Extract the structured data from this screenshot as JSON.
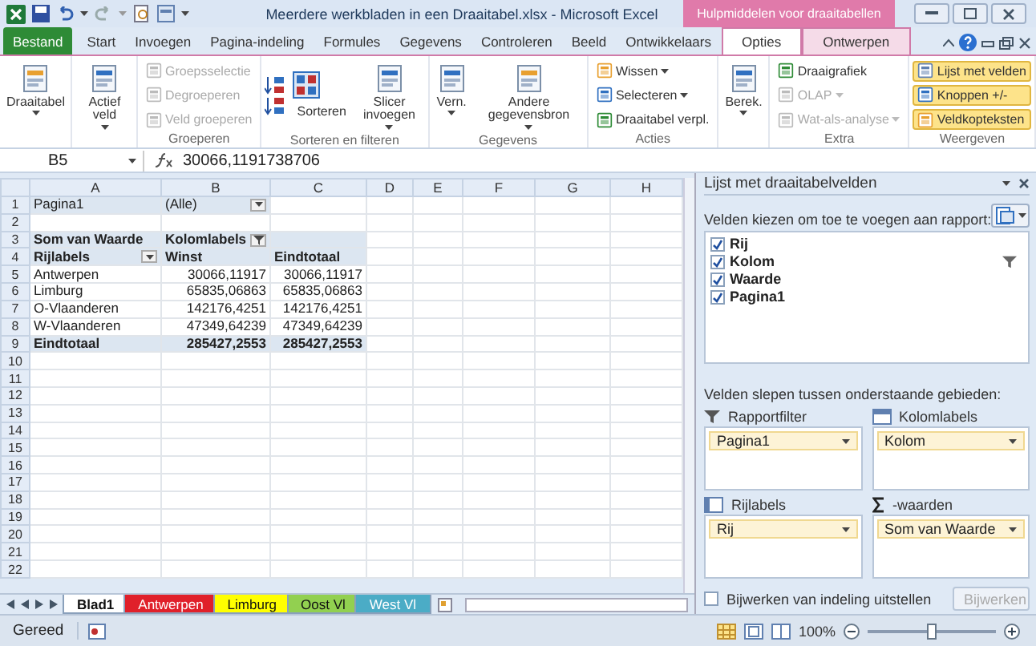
{
  "window": {
    "title": "Meerdere werkbladen in een Draaitabel.xlsx - Microsoft Excel",
    "context_label": "Hulpmiddelen voor draaitabellen"
  },
  "tabs": [
    {
      "label": "Bestand",
      "kind": "file",
      "selected": false
    },
    {
      "label": "Start",
      "kind": "normal",
      "selected": false
    },
    {
      "label": "Invoegen",
      "kind": "normal",
      "selected": false
    },
    {
      "label": "Pagina-indeling",
      "kind": "normal",
      "selected": false
    },
    {
      "label": "Formules",
      "kind": "normal",
      "selected": false
    },
    {
      "label": "Gegevens",
      "kind": "normal",
      "selected": false
    },
    {
      "label": "Controleren",
      "kind": "normal",
      "selected": false
    },
    {
      "label": "Beeld",
      "kind": "normal",
      "selected": false
    },
    {
      "label": "Ontwikkelaars",
      "kind": "normal",
      "selected": false
    },
    {
      "label": "Opties",
      "kind": "context",
      "selected": true
    },
    {
      "label": "Ontwerpen",
      "kind": "context",
      "selected": false
    }
  ],
  "ribbon_groups": [
    {
      "commands": [
        {
          "label": "Draaitabel",
          "kind": "large",
          "menu": true,
          "disabled": false,
          "selected": false
        }
      ]
    },
    {
      "commands": [
        {
          "label": "Actief veld",
          "kind": "large",
          "menu": true,
          "disabled": false,
          "selected": false
        }
      ]
    },
    {
      "label": "Groeperen",
      "commands": [
        {
          "label": "Groepsselectie",
          "kind": "small",
          "menu": false,
          "disabled": true,
          "selected": false
        },
        {
          "label": "Degroeperen",
          "kind": "small",
          "menu": false,
          "disabled": true,
          "selected": false
        },
        {
          "label": "Veld groeperen",
          "kind": "small",
          "menu": false,
          "disabled": true,
          "selected": false
        }
      ]
    },
    {
      "label": "Sorteren en filteren",
      "commands": [
        {
          "kind": "sort",
          "label": "Sorteren",
          "menu": false,
          "disabled": false,
          "selected": false
        },
        {
          "label": "Slicer invoegen",
          "kind": "large",
          "menu": true,
          "disabled": false,
          "selected": false
        }
      ]
    },
    {
      "label": "Gegevens",
      "commands": [
        {
          "label": "Vern.",
          "kind": "large",
          "menu": true,
          "disabled": false,
          "selected": false
        },
        {
          "label": "Andere gegevensbron",
          "kind": "large",
          "menu": true,
          "disabled": false,
          "selected": false
        }
      ]
    },
    {
      "label": "Acties",
      "commands": [
        {
          "label": "Wissen",
          "kind": "small",
          "menu": true,
          "disabled": false,
          "selected": false
        },
        {
          "label": "Selecteren",
          "kind": "small",
          "menu": true,
          "disabled": false,
          "selected": false
        },
        {
          "label": "Draaitabel verpl.",
          "kind": "small",
          "menu": false,
          "disabled": false,
          "selected": false
        }
      ]
    },
    {
      "commands": [
        {
          "label": "Berek.",
          "kind": "large",
          "menu": true,
          "disabled": false,
          "selected": false
        }
      ]
    },
    {
      "label": "Extra",
      "commands": [
        {
          "label": "Draaigrafiek",
          "kind": "small",
          "menu": false,
          "disabled": false,
          "selected": false
        },
        {
          "label": "OLAP",
          "kind": "small",
          "menu": true,
          "disabled": true,
          "selected": false
        },
        {
          "label": "Wat-als-analyse",
          "kind": "small",
          "menu": true,
          "disabled": true,
          "selected": false
        }
      ]
    },
    {
      "label": "Weergeven",
      "commands": [
        {
          "label": "Lijst met velden",
          "kind": "small",
          "menu": false,
          "disabled": false,
          "selected": true
        },
        {
          "label": "Knoppen +/-",
          "kind": "small",
          "menu": false,
          "disabled": false,
          "selected": true
        },
        {
          "label": "Veldkopteksten",
          "kind": "small",
          "menu": false,
          "disabled": false,
          "selected": true
        }
      ]
    }
  ],
  "formula_bar": {
    "cell": "B5",
    "value": "30066,1191738706"
  },
  "sheet": {
    "columns": [
      "A",
      "B",
      "C",
      "D",
      "E",
      "F",
      "G",
      "H"
    ],
    "rows": [
      {
        "number": "1",
        "kind": "filter",
        "cells": [
          "Pagina1",
          "(Alle)",
          null
        ]
      },
      {
        "number": "2",
        "kind": "blank",
        "cells": [
          null,
          null,
          null
        ]
      },
      {
        "number": "3",
        "kind": "header",
        "cells": [
          "Som van Waarde",
          "Kolomlabels",
          null
        ]
      },
      {
        "number": "4",
        "kind": "header",
        "cells": [
          "Rijlabels",
          "Winst",
          "Eindtotaal"
        ]
      },
      {
        "number": "5",
        "kind": "item",
        "cells": [
          "Antwerpen",
          "30066,11917",
          "30066,11917"
        ]
      },
      {
        "number": "6",
        "kind": "item",
        "cells": [
          "Limburg",
          "65835,06863",
          "65835,06863"
        ]
      },
      {
        "number": "7",
        "kind": "item",
        "cells": [
          "O-Vlaanderen",
          "142176,4251",
          "142176,4251"
        ]
      },
      {
        "number": "8",
        "kind": "item",
        "cells": [
          "W-Vlaanderen",
          "47349,64239",
          "47349,64239"
        ]
      },
      {
        "number": "9",
        "kind": "total",
        "cells": [
          "Eindtotaal",
          "285427,2553",
          "285427,2553"
        ]
      },
      {
        "number": "10",
        "kind": "blank",
        "cells": [
          null,
          null,
          null
        ]
      },
      {
        "number": "11",
        "kind": "blank",
        "cells": [
          null,
          null,
          null
        ]
      },
      {
        "number": "12",
        "kind": "blank",
        "cells": [
          null,
          null,
          null
        ]
      },
      {
        "number": "13",
        "kind": "blank",
        "cells": [
          null,
          null,
          null
        ]
      },
      {
        "number": "14",
        "kind": "blank",
        "cells": [
          null,
          null,
          null
        ]
      },
      {
        "number": "15",
        "kind": "blank",
        "cells": [
          null,
          null,
          null
        ]
      },
      {
        "number": "16",
        "kind": "blank",
        "cells": [
          null,
          null,
          null
        ]
      },
      {
        "number": "17",
        "kind": "blank",
        "cells": [
          null,
          null,
          null
        ]
      },
      {
        "number": "18",
        "kind": "blank",
        "cells": [
          null,
          null,
          null
        ]
      },
      {
        "number": "19",
        "kind": "blank",
        "cells": [
          null,
          null,
          null
        ]
      },
      {
        "number": "20",
        "kind": "blank",
        "cells": [
          null,
          null,
          null
        ]
      },
      {
        "number": "21",
        "kind": "blank",
        "cells": [
          null,
          null,
          null
        ]
      },
      {
        "number": "22",
        "kind": "blank",
        "cells": [
          null,
          null,
          null
        ]
      }
    ]
  },
  "sheet_tabs": [
    {
      "label": "Blad1",
      "selected": true,
      "color": "#ffffff"
    },
    {
      "label": "Antwerpen",
      "selected": false,
      "color": "#e0202a"
    },
    {
      "label": "Limburg",
      "selected": false,
      "color": "#ffff00"
    },
    {
      "label": "Oost Vl",
      "selected": false,
      "color": "#92d050"
    },
    {
      "label": "West Vl",
      "selected": false,
      "color": "#4bacc6"
    }
  ],
  "status_bar": {
    "status": "Gereed",
    "zoom": "100%",
    "zoom_slider": {
      "level": 0.5
    }
  },
  "field_list": {
    "title": "Lijst met draaitabelvelden",
    "choose_label": "Velden kiezen om toe te voegen aan rapport:",
    "fields": [
      {
        "label": "Rij",
        "checked": true,
        "filtered": false
      },
      {
        "label": "Kolom",
        "checked": true,
        "filtered": true
      },
      {
        "label": "Waarde",
        "checked": true,
        "filtered": false
      },
      {
        "label": "Pagina1",
        "checked": true,
        "filtered": false
      }
    ],
    "drag_label": "Velden slepen tussen onderstaande gebieden:",
    "areas": [
      {
        "kind": "filter",
        "label": "Rapportfilter",
        "items": [
          "Pagina1"
        ]
      },
      {
        "kind": "columns",
        "label": "Kolomlabels",
        "items": [
          "Kolom"
        ]
      },
      {
        "kind": "rows",
        "label": "Rijlabels",
        "items": [
          "Rij"
        ]
      },
      {
        "kind": "values",
        "label": "-waarden",
        "items": [
          "Som van Waarde"
        ]
      }
    ],
    "defer": {
      "label": "Bijwerken van indeling uitstellen",
      "checked": false
    },
    "update_button": {
      "label": "Bijwerken",
      "disabled": true
    }
  }
}
